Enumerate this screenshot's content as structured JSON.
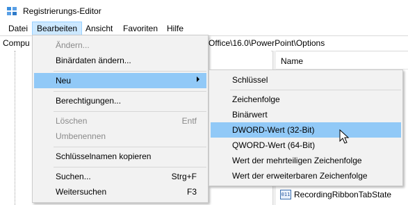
{
  "window": {
    "title": "Registrierungs-Editor"
  },
  "menubar": {
    "items": [
      {
        "label": "Datei"
      },
      {
        "label": "Bearbeiten"
      },
      {
        "label": "Ansicht"
      },
      {
        "label": "Favoriten"
      },
      {
        "label": "Hilfe"
      }
    ]
  },
  "address": {
    "left": "Compu",
    "right": "Office\\16.0\\PowerPoint\\Options"
  },
  "list": {
    "name_header": "Name",
    "rows": [
      {
        "name": "RecordingRibbonTabState"
      }
    ]
  },
  "edit_menu": {
    "items": [
      {
        "label": "Ändern..."
      },
      {
        "label": "Binärdaten ändern..."
      },
      {
        "label": "Neu"
      },
      {
        "label": "Berechtigungen..."
      },
      {
        "label": "Löschen",
        "shortcut": "Entf"
      },
      {
        "label": "Umbenennen"
      },
      {
        "label": "Schlüsselnamen kopieren"
      },
      {
        "label": "Suchen...",
        "shortcut": "Strg+F"
      },
      {
        "label": "Weitersuchen",
        "shortcut": "F3"
      }
    ]
  },
  "new_submenu": {
    "items": [
      {
        "label": "Schlüssel"
      },
      {
        "label": "Zeichenfolge"
      },
      {
        "label": "Binärwert"
      },
      {
        "label": "DWORD-Wert (32-Bit)"
      },
      {
        "label": "QWORD-Wert (64-Bit)"
      },
      {
        "label": "Wert der mehrteiligen Zeichenfolge"
      },
      {
        "label": "Wert der erweiterbaren Zeichenfolge"
      }
    ]
  },
  "colors": {
    "highlight": "#91c9f7",
    "menu_bg": "#f2f2f2",
    "menubar_active": "#cce8ff"
  }
}
